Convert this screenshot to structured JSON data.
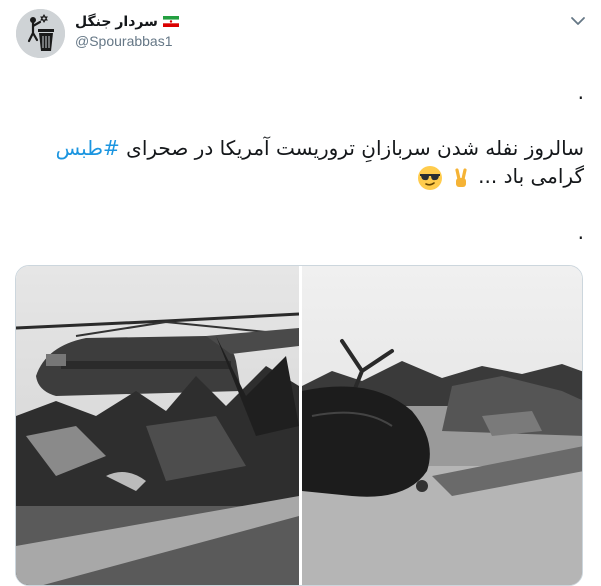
{
  "user": {
    "display_name": "سردار جنگل",
    "handle": "@Spourabbas1"
  },
  "icons": {
    "avatar": "trash-can-star-icon",
    "flag": "iran-flag-icon",
    "menu": "chevron-down-icon",
    "emoji_1": "sunglasses-face-icon",
    "emoji_2": "victory-hand-icon"
  },
  "tweet": {
    "line_dot_1": ".",
    "line1_text": "سالروز نفله شدن سربازانِ تروریست آمریکا در صحرای ",
    "hashtag": "#طبس",
    "line2_text": "گرامی باد ...",
    "line_dot_2": "."
  },
  "colors": {
    "hashtag": "#1b95e0",
    "handle": "#657786",
    "text": "#14171a",
    "border": "#ccd6dd"
  }
}
